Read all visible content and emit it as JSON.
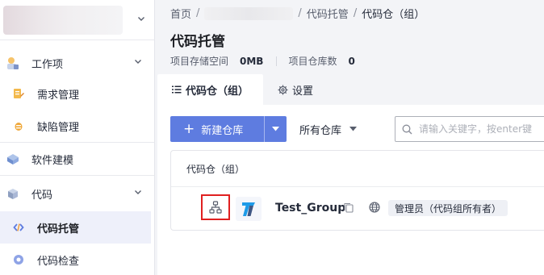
{
  "sidebar": {
    "groups": {
      "work": "工作项",
      "modeling": "软件建模",
      "code": "代码"
    },
    "items": {
      "requirements": "需求管理",
      "defects": "缺陷管理",
      "code_hosting": "代码托管",
      "code_check": "代码检查"
    }
  },
  "breadcrumb": {
    "home": "首页",
    "sep": "/",
    "code_hosting": "代码托管",
    "current": "代码仓（组）"
  },
  "page": {
    "title": "代码托管",
    "storage_label": "项目存储空间",
    "storage_value": "0MB",
    "repo_count_label": "项目仓库数",
    "repo_count_value": "0"
  },
  "tabs": {
    "repos": "代码仓（组）",
    "settings": "设置"
  },
  "toolbar": {
    "new_repo": "新建仓库",
    "filter": "所有仓库",
    "search_placeholder": "请输入关键字，按enter键"
  },
  "list": {
    "header": "代码仓（组）",
    "rows": [
      {
        "name": "Test_Group",
        "role": "管理员（代码组所有者）",
        "logo_letter": "T"
      }
    ]
  },
  "colors": {
    "primary": "#5e7ce0",
    "highlight_border": "#e02020",
    "logo_blue": "#1e9be8",
    "logo_dark": "#1f3b6f"
  }
}
